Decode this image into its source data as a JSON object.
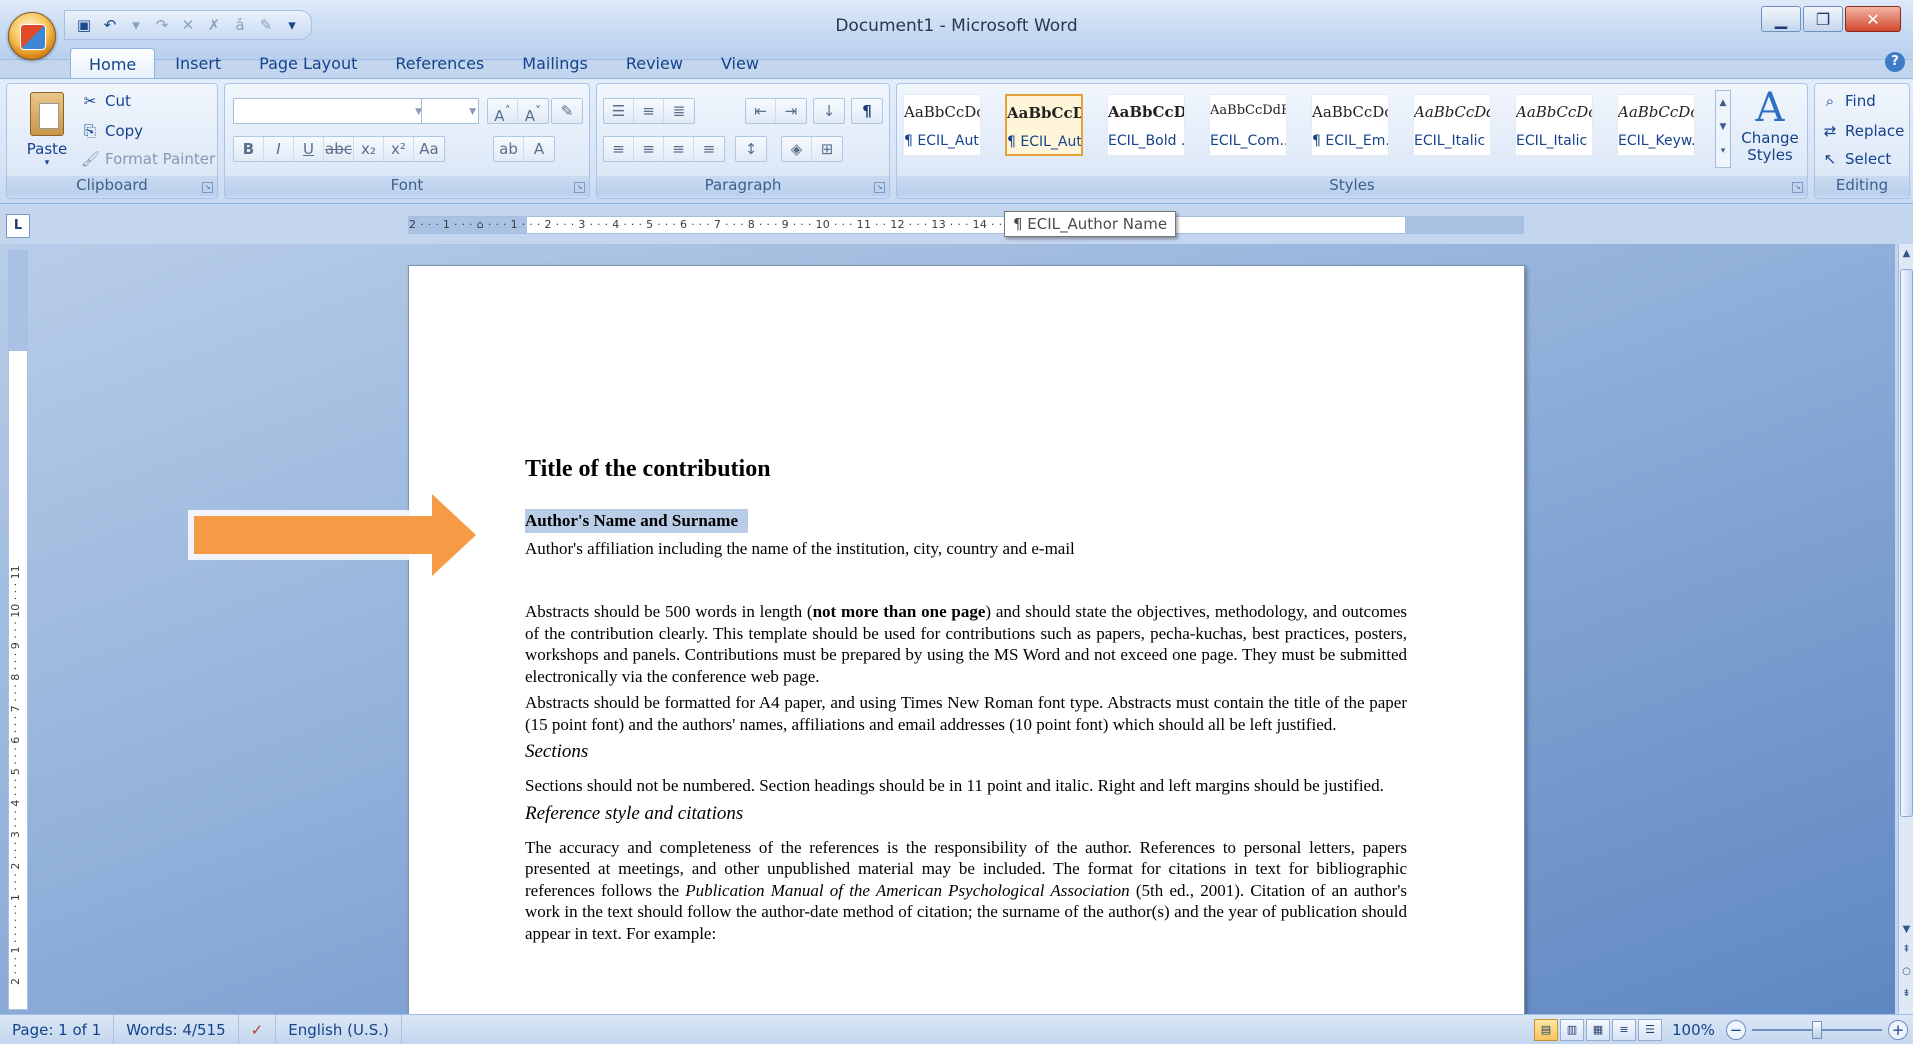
{
  "window": {
    "title": "Document1 - Microsoft Word"
  },
  "quick_access": {
    "save": "💾",
    "undo": "↶",
    "redo": "↷",
    "more": "▾"
  },
  "tabs": [
    {
      "label": "Home",
      "active": true
    },
    {
      "label": "Insert"
    },
    {
      "label": "Page Layout"
    },
    {
      "label": "References"
    },
    {
      "label": "Mailings"
    },
    {
      "label": "Review"
    },
    {
      "label": "View"
    }
  ],
  "ribbon": {
    "clipboard": {
      "label": "Clipboard",
      "paste": "Paste",
      "cut": "Cut",
      "copy": "Copy",
      "format_painter": "Format Painter"
    },
    "font": {
      "label": "Font",
      "font_name": "",
      "font_size": ""
    },
    "paragraph": {
      "label": "Paragraph"
    },
    "styles": {
      "label": "Styles",
      "items": [
        {
          "preview": "AaBbCcDc",
          "name": "¶ ECIL_Aut..."
        },
        {
          "preview": "AaBbCcDd",
          "name": "¶ ECIL_Aut...",
          "selected": true
        },
        {
          "preview": "AaBbCcDd",
          "name": "ECIL_Bold ..."
        },
        {
          "preview": "AaBbCcDdE",
          "name": "ECIL_Com..."
        },
        {
          "preview": "AaBbCcDc",
          "name": "¶ ECIL_Em..."
        },
        {
          "preview": "AaBbCcDdE",
          "name": "ECIL_Italic ..."
        },
        {
          "preview": "AaBbCcDc",
          "name": "ECIL_Italic ..."
        },
        {
          "preview": "AaBbCcDc",
          "name": "ECIL_Keyw..."
        }
      ],
      "change_styles": "Change Styles"
    },
    "editing": {
      "label": "Editing",
      "find": "Find",
      "replace": "Replace",
      "select": "Select"
    }
  },
  "ruler": {
    "numbers": "2 · · · 1 · · · ⌂ · · · 1 · · · 2 · · · 3 · · · 4 · · · 5 · · · 6 · · · 7 · · · 8 · · · 9 · · · 10 · · · 11 · · 12 · · · 13 · · · 14 · · · 15 · · · 16 · · · 17 · · · 18 · · ·",
    "vertical": "2 · · · 1 · · · · · · 1 · · · 2 · · · 3 · · · 4 · · · 5 · · · 6 · · · 7 · · · 8 · · · 9 · · · 10 · · · 11"
  },
  "tooltip": "¶ ECIL_Author Name",
  "document": {
    "title": "Title of the contribution",
    "author": "Author's Name and Surname",
    "affiliation": "Author's affiliation including the name of the institution, city, country and e-mail",
    "p1_before": "Abstracts should be 500 words in length (",
    "p1_bold": "not more than one page",
    "p1_after": ") and should state the objectives, methodology, and outcomes of the contribution clearly. This template should be used for contributions such as papers, pecha-kuchas, best practices, posters, workshops and panels. Contributions must be prepared by using the MS Word and not exceed one page. They must be submitted electronically via the conference web page.",
    "p2": "Abstracts should be formatted for A4 paper, and using Times New Roman font type. Abstracts must contain the title of the paper (15 point font) and the authors' names, affiliations and email addresses (10 point font) which should all be left justified.",
    "h1": "Sections",
    "p3": "Sections should not be numbered. Section headings should be in 11 point and italic. Right and left margins should be justified.",
    "h2": "Reference style and citations",
    "p4_before": "The accuracy and completeness of the references is the responsibility of the author. References to personal letters, papers presented at meetings, and other unpublished material may be included. The format for citations in text for bibliographic references follows the ",
    "p4_italic": "Publication Manual of the American Psychological Association",
    "p4_after": " (5th ed., 2001). Citation of an author's work in the text should follow the author-date method of citation; the surname of the author(s) and the year of publication should appear in text. For example:"
  },
  "status": {
    "page": "Page: 1 of 1",
    "words": "Words: 4/515",
    "language": "English (U.S.)",
    "zoom": "100%"
  },
  "colors": {
    "arrow": "#f59a45",
    "selection": "#b9cde6",
    "ribbon": "#dde8f7"
  }
}
